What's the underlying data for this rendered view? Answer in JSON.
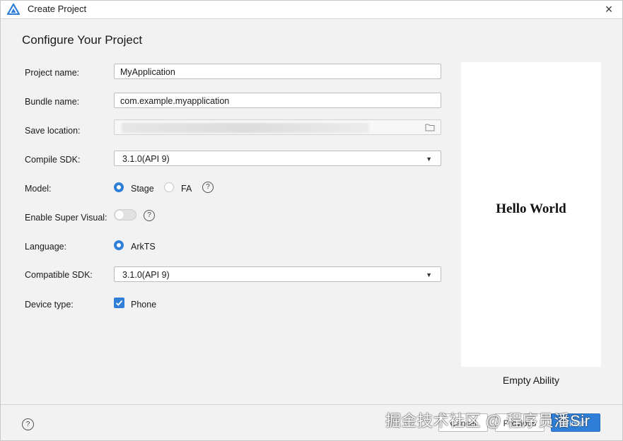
{
  "window": {
    "title": "Create Project",
    "close_label": "×",
    "app_icon": "deveco-logo-icon"
  },
  "heading": "Configure Your Project",
  "form": {
    "project_name": {
      "label": "Project name:",
      "value": "MyApplication"
    },
    "bundle_name": {
      "label": "Bundle name:",
      "value": "com.example.myapplication"
    },
    "save_location": {
      "label": "Save location:",
      "value": ""
    },
    "compile_sdk": {
      "label": "Compile SDK:",
      "value": "3.1.0(API 9)"
    },
    "model": {
      "label": "Model:",
      "options": [
        "Stage",
        "FA"
      ],
      "selected": "Stage"
    },
    "super_visual": {
      "label": "Enable Super Visual:",
      "enabled": false
    },
    "language": {
      "label": "Language:",
      "options": [
        "ArkTS"
      ],
      "selected": "ArkTS"
    },
    "compatible_sdk": {
      "label": "Compatible SDK:",
      "value": "3.1.0(API 9)"
    },
    "device_type": {
      "label": "Device type:",
      "options": [
        "Phone"
      ],
      "checked": true
    }
  },
  "help_glyph": "?",
  "preview": {
    "text": "Hello World",
    "template_name": "Empty Ability"
  },
  "footer": {
    "cancel_label": "Cancel",
    "previous_label": "Previous",
    "finish_label": "Finish"
  },
  "watermark": "掘金技术社区 @ 程序员潘Sir",
  "colors": {
    "accent": "#2f7fd8"
  }
}
